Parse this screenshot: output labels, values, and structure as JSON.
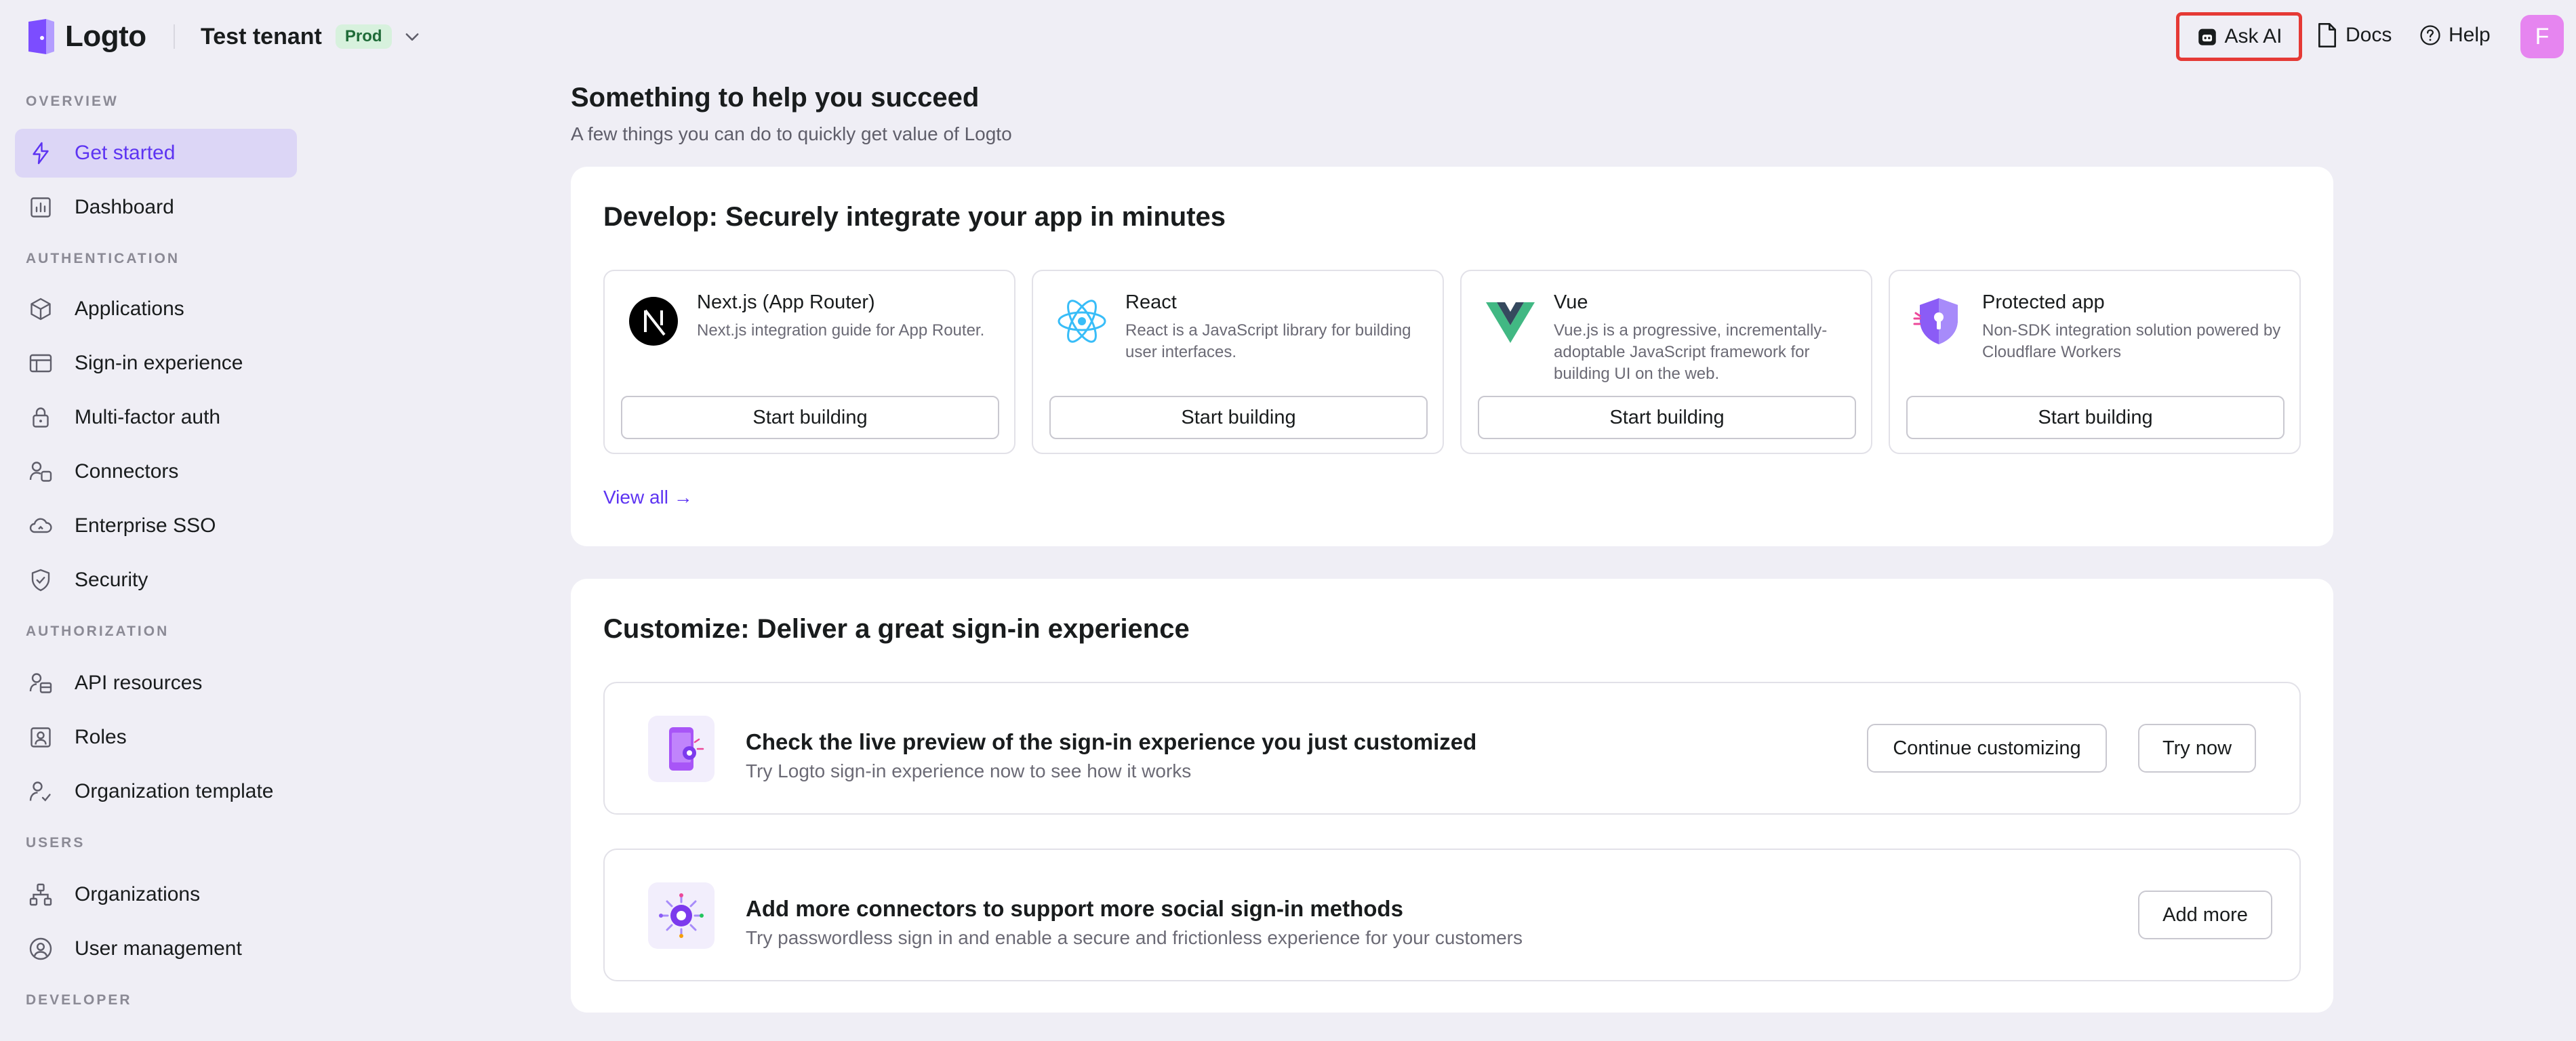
{
  "app": {
    "name": "Logto"
  },
  "tenant": {
    "name": "Test tenant",
    "badge": "Prod"
  },
  "topbar": {
    "ask_ai": "Ask AI",
    "docs": "Docs",
    "help": "Help",
    "avatar_initial": "F"
  },
  "sidebar": {
    "sections": {
      "overview": "OVERVIEW",
      "authentication": "AUTHENTICATION",
      "authorization": "AUTHORIZATION",
      "users": "USERS",
      "developer": "DEVELOPER"
    },
    "items": {
      "get_started": "Get started",
      "dashboard": "Dashboard",
      "applications": "Applications",
      "sign_in_experience": "Sign-in experience",
      "mfa": "Multi-factor auth",
      "connectors": "Connectors",
      "enterprise_sso": "Enterprise SSO",
      "security": "Security",
      "api_resources": "API resources",
      "roles": "Roles",
      "organization_template": "Organization template",
      "organizations": "Organizations",
      "user_management": "User management"
    }
  },
  "main": {
    "heading": "Something to help you succeed",
    "subheading": "A few things you can do to quickly get value of Logto",
    "develop": {
      "title": "Develop: Securely integrate your app in minutes",
      "tiles": [
        {
          "name": "Next.js (App Router)",
          "description": "Next.js integration guide for App Router.",
          "button": "Start building"
        },
        {
          "name": "React",
          "description": "React is a JavaScript library for building user interfaces.",
          "button": "Start building"
        },
        {
          "name": "Vue",
          "description": "Vue.js is a progressive, incrementally-adoptable JavaScript framework for building UI on the web.",
          "button": "Start building"
        },
        {
          "name": "Protected app",
          "description": "Non-SDK integration solution powered by Cloudflare Workers",
          "button": "Start building"
        }
      ],
      "view_all": "View all →"
    },
    "customize": {
      "title": "Customize: Deliver a great sign-in experience",
      "rows": [
        {
          "title": "Check the live preview of the sign-in experience you just customized",
          "subtitle": "Try Logto sign-in experience now to see how it works",
          "primary_button": "Continue customizing",
          "secondary_button": "Try now"
        },
        {
          "title": "Add more connectors to support more social sign-in methods",
          "subtitle": "Try passwordless sign in and enable a secure and frictionless experience for your customers",
          "primary_button": "Add more"
        }
      ]
    }
  },
  "colors": {
    "accent": "#5d34f2",
    "active_bg": "#dcd6f6",
    "page_bg": "#efeef5",
    "badge_bg": "#d7f1dd",
    "highlight": "#e53935"
  }
}
